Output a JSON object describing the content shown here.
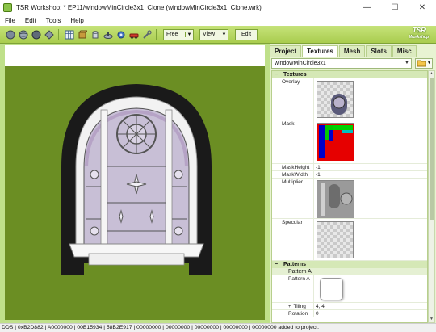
{
  "window": {
    "title": "TSR Workshop: * EP11/windowMinCircle3x1_Clone (windowMinCircle3x1_Clone.wrk)",
    "controls": [
      "minimize-icon",
      "maximize-icon",
      "close-icon"
    ]
  },
  "menu": [
    "File",
    "Edit",
    "Tools",
    "Help"
  ],
  "toolbar": {
    "tool_icons": [
      "sphere-icon",
      "sphere-icon",
      "sphere-icon",
      "diamond-icon",
      "grid-icon",
      "box-icon",
      "cylinder-icon",
      "disk-icon",
      "gear-icon",
      "car-icon",
      "wrench-icon"
    ],
    "camera_mode": "Free",
    "view_label": "View",
    "edit_label": "Edit",
    "logo": {
      "line1": "TSR",
      "line2": "Workshop"
    }
  },
  "panel": {
    "tabs": [
      "Project",
      "Textures",
      "Mesh",
      "Slots",
      "Misc"
    ],
    "active_tab": "Textures",
    "selected_object": "windowMinCircle3x1",
    "textures_section": {
      "title": "Textures",
      "rows": {
        "overlay": "Overlay",
        "mask": "Mask",
        "mask_height_label": "MaskHeight",
        "mask_height_value": "-1",
        "mask_width_label": "MaskWidth",
        "mask_width_value": "-1",
        "multiplier": "Multiplier",
        "specular": "Specular"
      }
    },
    "patterns_section": {
      "title": "Patterns",
      "subsection": "Pattern A",
      "pattern_label": "Pattern A",
      "tiling_label": "Tiling",
      "tiling_value": "4, 4",
      "rotation_label": "Rotation",
      "rotation_value": "0"
    }
  },
  "status": "DDS | 0xB2D882 | A0000000 | 00B15934 | 58B2E917 | 00000000 | 00000000 | 00000000 | 00000000 | 00000000 added to project.",
  "colors": {
    "accent": "#a9cc4e",
    "viewport_ground": "#6b8e23",
    "panel_bg": "#e8f3d2"
  }
}
